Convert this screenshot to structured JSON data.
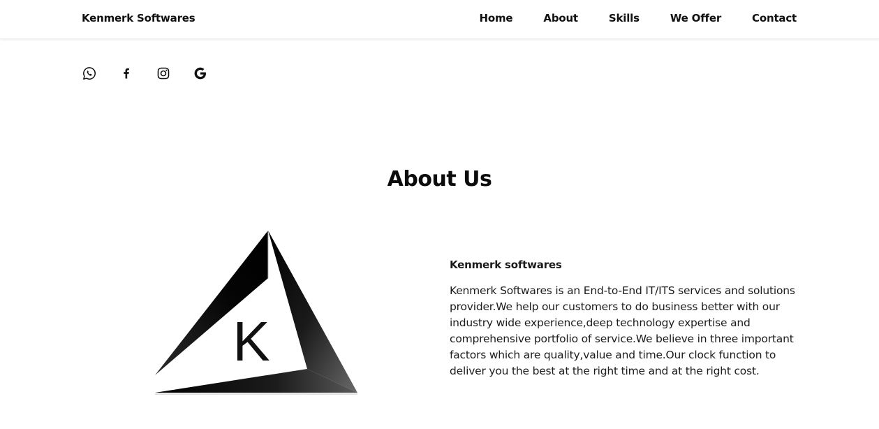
{
  "header": {
    "brand": "Kenmerk Softwares",
    "nav": [
      "Home",
      "About",
      "Skills",
      "We Offer",
      "Contact"
    ]
  },
  "social": {
    "icons": [
      "whatsapp-icon",
      "facebook-icon",
      "instagram-icon",
      "google-icon"
    ]
  },
  "about": {
    "title": "About Us",
    "logo_letter": "K",
    "heading": "Kenmerk softwares",
    "body": "Kenmerk Softwares is an End-to-End IT/ITS services and solutions provider.We help our customers to do business better with our industry wide experience,deep technology expertise and comprehensive portfolio of service.We believe in three important factors which are quality,value and time.Our clock function to deliver you the best at the right time and at the right cost."
  },
  "colors": {
    "text": "#111111",
    "background": "#ffffff",
    "logo_dark": "#0a0a0a",
    "logo_mid": "#555555"
  }
}
